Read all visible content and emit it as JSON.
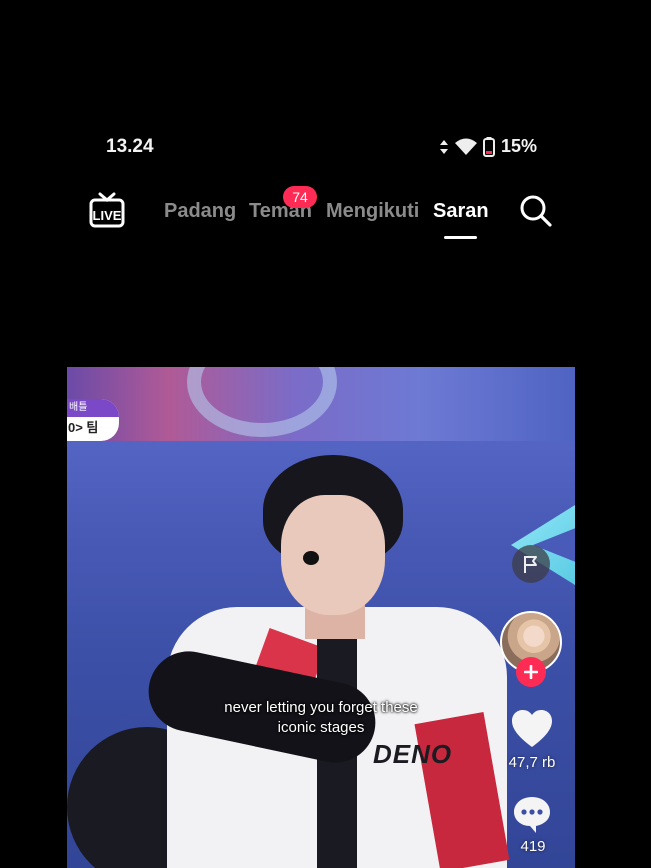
{
  "status": {
    "time": "13.24",
    "battery": "15%"
  },
  "nav": {
    "live_label": "LIVE",
    "tabs": [
      {
        "label": "Padang",
        "active": false
      },
      {
        "label": "Teman",
        "active": false
      },
      {
        "label": "Mengikuti",
        "active": false
      },
      {
        "label": "Saran",
        "active": true
      }
    ],
    "friends_badge": "74"
  },
  "video": {
    "tag_top": "배틀",
    "tag_bottom": "0> 팀",
    "jacket_text": "DENO",
    "caption_line1": "never letting you forget these",
    "caption_line2": "iconic stages"
  },
  "actions": {
    "likes": "47,7 rb",
    "comments": "419"
  },
  "colors": {
    "accent": "#fe2c55",
    "inactive_tab": "#8b8b8b"
  }
}
